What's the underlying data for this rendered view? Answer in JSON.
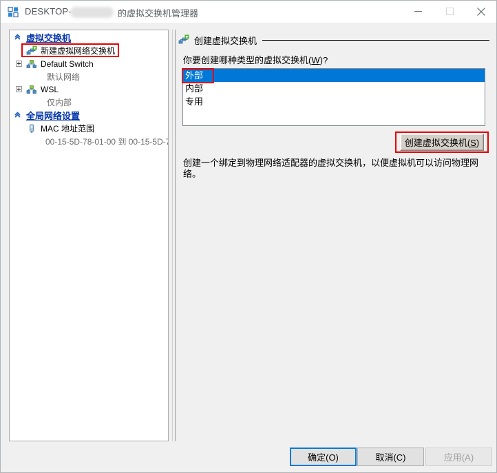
{
  "window": {
    "title_prefix": "DESKTOP-",
    "title_suffix": "的虚拟交换机管理器",
    "icon": "hyper-v-manager-icon",
    "controls": {
      "minimize": "minimize-icon",
      "maximize": "maximize-icon",
      "close": "close-icon"
    }
  },
  "sidebar": {
    "sections": [
      {
        "label": "虚拟交换机",
        "icon": "chevron-up-icon",
        "items": [
          {
            "label": "新建虚拟网络交换机",
            "icon": "new-virtual-switch-icon",
            "expandable": false,
            "sublabel": null,
            "selected": false
          },
          {
            "label": "Default Switch",
            "icon": "virtual-switch-icon",
            "expandable": true,
            "sublabel": "默认网络",
            "selected": false
          },
          {
            "label": "WSL",
            "icon": "virtual-switch-icon",
            "expandable": true,
            "sublabel": "仅内部",
            "selected": false
          }
        ]
      },
      {
        "label": "全局网络设置",
        "icon": "chevron-up-icon",
        "items": [
          {
            "label": "MAC 地址范围",
            "icon": "mac-address-icon",
            "expandable": false,
            "sublabel": "00-15-5D-78-01-00 到 00-15-5D-7...",
            "selected": false
          }
        ]
      }
    ]
  },
  "main": {
    "group_header": {
      "label": "创建虚拟交换机",
      "icon": "new-virtual-switch-icon"
    },
    "prompt": "你要创建哪种类型的虚拟交换机(W)?",
    "prompt_text": "你要创建哪种类型的虚拟交换机",
    "prompt_accel": "W",
    "prompt_tail": ")?",
    "switch_types": [
      {
        "label": "外部",
        "selected": true
      },
      {
        "label": "内部",
        "selected": false
      },
      {
        "label": "专用",
        "selected": false
      }
    ],
    "create_button": {
      "text": "创建虚拟交换机",
      "accel": "S",
      "tail": ")"
    },
    "description": "创建一个绑定到物理网络适配器的虚拟交换机，以便虚拟机可以访问物理网络。"
  },
  "footer": {
    "ok": "确定(O)",
    "cancel": "取消(C)",
    "apply": "应用(A)",
    "apply_disabled": true
  },
  "annotations": {
    "color": "#e60000",
    "boxes": [
      "新建虚拟网络交换机",
      "外部",
      "创建虚拟交换机(S)"
    ]
  },
  "colors": {
    "selection_blue": "#0078d7",
    "link_blue": "#0033aa",
    "window_bg": "#f0f0f0",
    "annotation_red": "#e60000"
  }
}
